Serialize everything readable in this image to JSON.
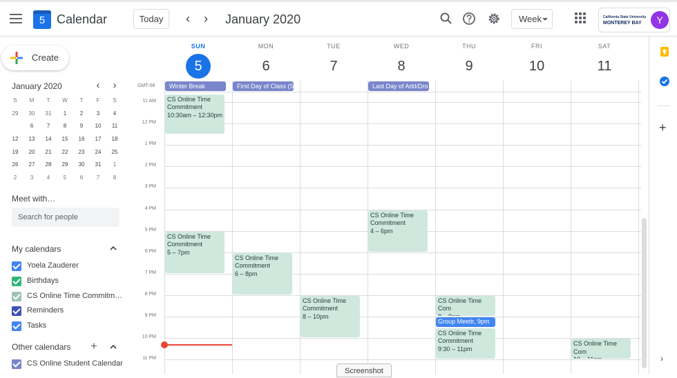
{
  "header": {
    "app_title": "Calendar",
    "logo_day": "5",
    "today_label": "Today",
    "prev_symbol": "‹",
    "next_symbol": "›",
    "month_title": "January 2020",
    "view_label": "Week",
    "org": {
      "line1": "California State University",
      "line2": "MONTEREY BAY"
    },
    "avatar_initial": "Y",
    "icons": [
      "menu-icon",
      "search-icon",
      "help-icon",
      "settings-icon",
      "apps-icon"
    ]
  },
  "sidebar": {
    "create_label": "Create",
    "mini_month_title": "January 2020",
    "mini_dow": [
      "S",
      "M",
      "T",
      "W",
      "T",
      "F",
      "S"
    ],
    "mini_weeks": [
      [
        "29",
        "30",
        "31",
        "1",
        "2",
        "3",
        "4"
      ],
      [
        "5",
        "6",
        "7",
        "8",
        "9",
        "10",
        "11"
      ],
      [
        "12",
        "13",
        "14",
        "15",
        "16",
        "17",
        "18"
      ],
      [
        "19",
        "20",
        "21",
        "22",
        "23",
        "24",
        "25"
      ],
      [
        "26",
        "27",
        "28",
        "29",
        "30",
        "31",
        "1"
      ],
      [
        "2",
        "3",
        "4",
        "5",
        "6",
        "7",
        "8"
      ]
    ],
    "mini_selected": "5",
    "meet_title": "Meet with…",
    "search_placeholder": "Search for people",
    "my_calendars_title": "My calendars",
    "my_calendars": [
      {
        "label": "Yoela Zauderer",
        "color": "#4285f4"
      },
      {
        "label": "Birthdays",
        "color": "#33b679"
      },
      {
        "label": "CS Online Time Commitm…",
        "color": "#a0c3b8"
      },
      {
        "label": "Reminders",
        "color": "#3f51b5"
      },
      {
        "label": "Tasks",
        "color": "#4285f4"
      }
    ],
    "other_calendars_title": "Other calendars",
    "other_calendars": [
      {
        "label": "CS Online Student Calendar",
        "color": "#7986cb"
      }
    ]
  },
  "week": {
    "timezone": "GMT-08",
    "days": [
      {
        "dow": "SUN",
        "num": "5",
        "selected": true
      },
      {
        "dow": "MON",
        "num": "6",
        "selected": false
      },
      {
        "dow": "TUE",
        "num": "7",
        "selected": false
      },
      {
        "dow": "WED",
        "num": "8",
        "selected": false
      },
      {
        "dow": "THU",
        "num": "9",
        "selected": false
      },
      {
        "dow": "FRI",
        "num": "10",
        "selected": false
      },
      {
        "dow": "SAT",
        "num": "11",
        "selected": false
      }
    ],
    "hours": [
      "11 AM",
      "12 PM",
      "1 PM",
      "2 PM",
      "3 PM",
      "4 PM",
      "5 PM",
      "6 PM",
      "7 PM",
      "8 PM",
      "9 PM",
      "10 PM",
      "11 PM"
    ],
    "allday_events": [
      {
        "title": "Winter Break",
        "color": "#7986cb"
      },
      {
        "title": "First Day of Class (S",
        "color": "#7986cb"
      },
      {
        "title": "Last Day of Add/Dro",
        "color": "#7986cb"
      }
    ],
    "events": [
      {
        "title": "CS Online Time Commitment",
        "time": "10:30am – 12:30pm"
      },
      {
        "title": "CS Online Time Commitment",
        "time": "5 – 7pm"
      },
      {
        "title": "CS Online Time Commitment",
        "time": "6 – 8pm"
      },
      {
        "title": "CS Online Time Commitment",
        "time": "8 – 10pm"
      },
      {
        "title": "CS Online Time Commitment",
        "time": "4 – 6pm"
      },
      {
        "title": "CS Online Time Com",
        "time": "8 – 9pm"
      },
      {
        "title": "Group Meetir, 9pm",
        "time": ""
      },
      {
        "title": "CS Online Time Commitment",
        "time": "9:30 – 11pm"
      },
      {
        "title": "CS Online Time Com",
        "time": "10 – 11pm"
      }
    ]
  },
  "tooltip": "Screenshot",
  "colors": {
    "accent": "#1a73e8",
    "event_bg": "#cfe8de",
    "now_line": "#ea4335"
  }
}
